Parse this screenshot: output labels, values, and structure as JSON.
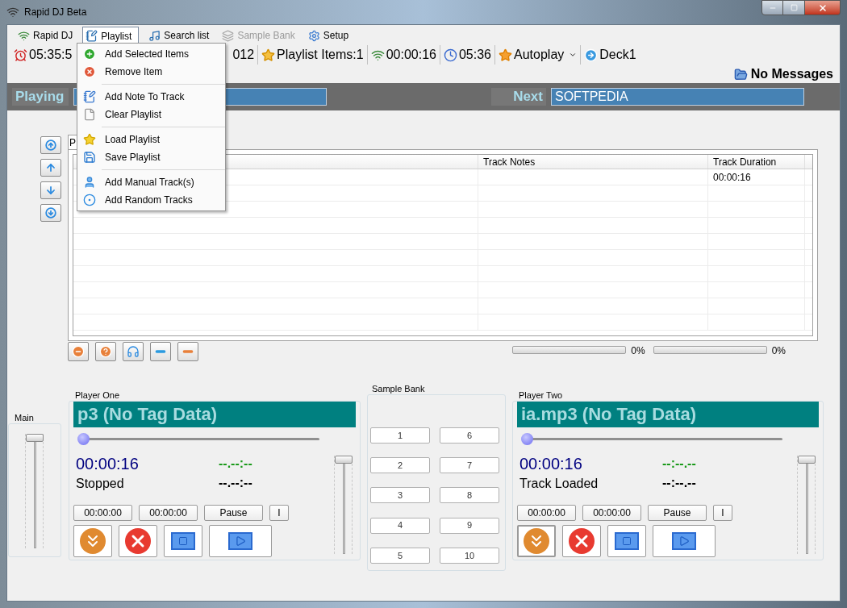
{
  "window": {
    "title": "Rapid DJ Beta"
  },
  "menu_bar": [
    {
      "label": "Rapid DJ",
      "selected": false,
      "disabled": false
    },
    {
      "label": "Playlist",
      "selected": true,
      "disabled": false
    },
    {
      "label": "Search list",
      "selected": false,
      "disabled": false
    },
    {
      "label": "Sample Bank",
      "selected": false,
      "disabled": true
    },
    {
      "label": "Setup",
      "selected": false,
      "disabled": false
    }
  ],
  "playlist_menu": {
    "groups": [
      [
        "Add Selected Items",
        "Remove Item"
      ],
      [
        "Add Note To Track",
        "Clear Playlist"
      ],
      [
        "Load Playlist",
        "Save Playlist"
      ],
      [
        "Add Manual Track(s)",
        "Add Random Tracks"
      ]
    ]
  },
  "toolbar": [
    {
      "kind": "clock",
      "text": "05:35:5"
    },
    {
      "kind": "date",
      "text": "012"
    },
    {
      "kind": "items",
      "text": "Playlist Items:1"
    },
    {
      "kind": "elapsed",
      "text": "00:00:16"
    },
    {
      "kind": "remaining",
      "text": "05:36"
    },
    {
      "kind": "autoplay",
      "text": "Autoplay"
    },
    {
      "kind": "deck",
      "text": "Deck1"
    }
  ],
  "messages": "No Messages",
  "now": {
    "playing_label": "Playing",
    "next_label": "Next",
    "next_value": "SOFTPEDIA"
  },
  "tab": {
    "label": "P"
  },
  "table": {
    "columns": [
      "Track Notes",
      "Track Duration"
    ],
    "rows": [
      {
        "duration": "00:00:16"
      }
    ]
  },
  "progress": [
    {
      "level": 0,
      "reading": "0%"
    },
    {
      "level": 0,
      "reading": "0%"
    }
  ],
  "main": {
    "label": "Main",
    "level": 0.97
  },
  "players": [
    {
      "title": "Player One",
      "track": "p3 (No Tag Data)",
      "seek": {
        "level": 0
      },
      "time": "00:00:16",
      "status": "Stopped",
      "counter_green": "--.--:--",
      "counter_black": "--.--:--",
      "cue_in": "00:00:00",
      "cue_out": "00:00:00",
      "pause": "Pause",
      "mark": "I",
      "volume": {
        "level": 0.97
      },
      "eject_focused": false
    },
    {
      "title": "Player Two",
      "track": "ia.mp3 (No Tag Data)",
      "seek": {
        "level": 0
      },
      "time": "00:00:16",
      "status": "Track Loaded",
      "counter_green": "--:--.--",
      "counter_black": "--:--.--",
      "cue_in": "00:00:00",
      "cue_out": "00:00:00",
      "pause": "Pause",
      "mark": "I",
      "volume": {
        "level": 0.97
      },
      "eject_focused": true
    }
  ],
  "sample_bank": {
    "title": "Sample Bank",
    "pads": [
      "1",
      "2",
      "3",
      "4",
      "5",
      "6",
      "7",
      "8",
      "9",
      "10"
    ]
  }
}
